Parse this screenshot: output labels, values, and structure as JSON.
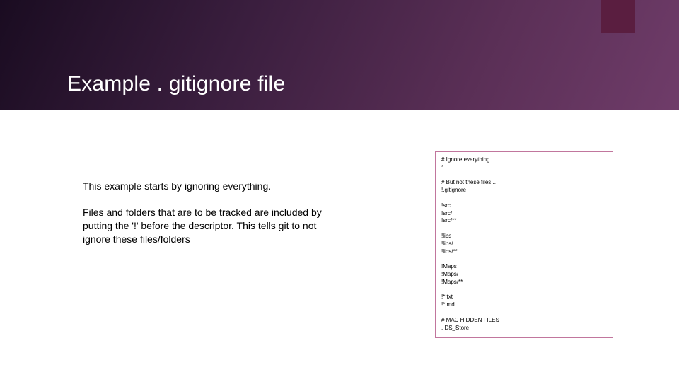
{
  "title": "Example . gitignore file",
  "body": {
    "p1": "This example starts by ignoring everything.",
    "p2": "Files and folders that are to be tracked are included by putting the '!' before the descriptor. This tells git to not ignore these files/folders"
  },
  "code": "# Ignore everything\n*\n\n# But not these files...\n!.gitignore\n\n!src\n!src/\n!src/**\n\n!libs\n!libs/\n!libs/**\n\n!Maps\n!Maps/\n!Maps/**\n\n!*.txt\n!*.md\n\n# MAC HIDDEN FILES\n. DS_Store",
  "colors": {
    "accent": "#5a1e40",
    "border": "#c1769d"
  }
}
